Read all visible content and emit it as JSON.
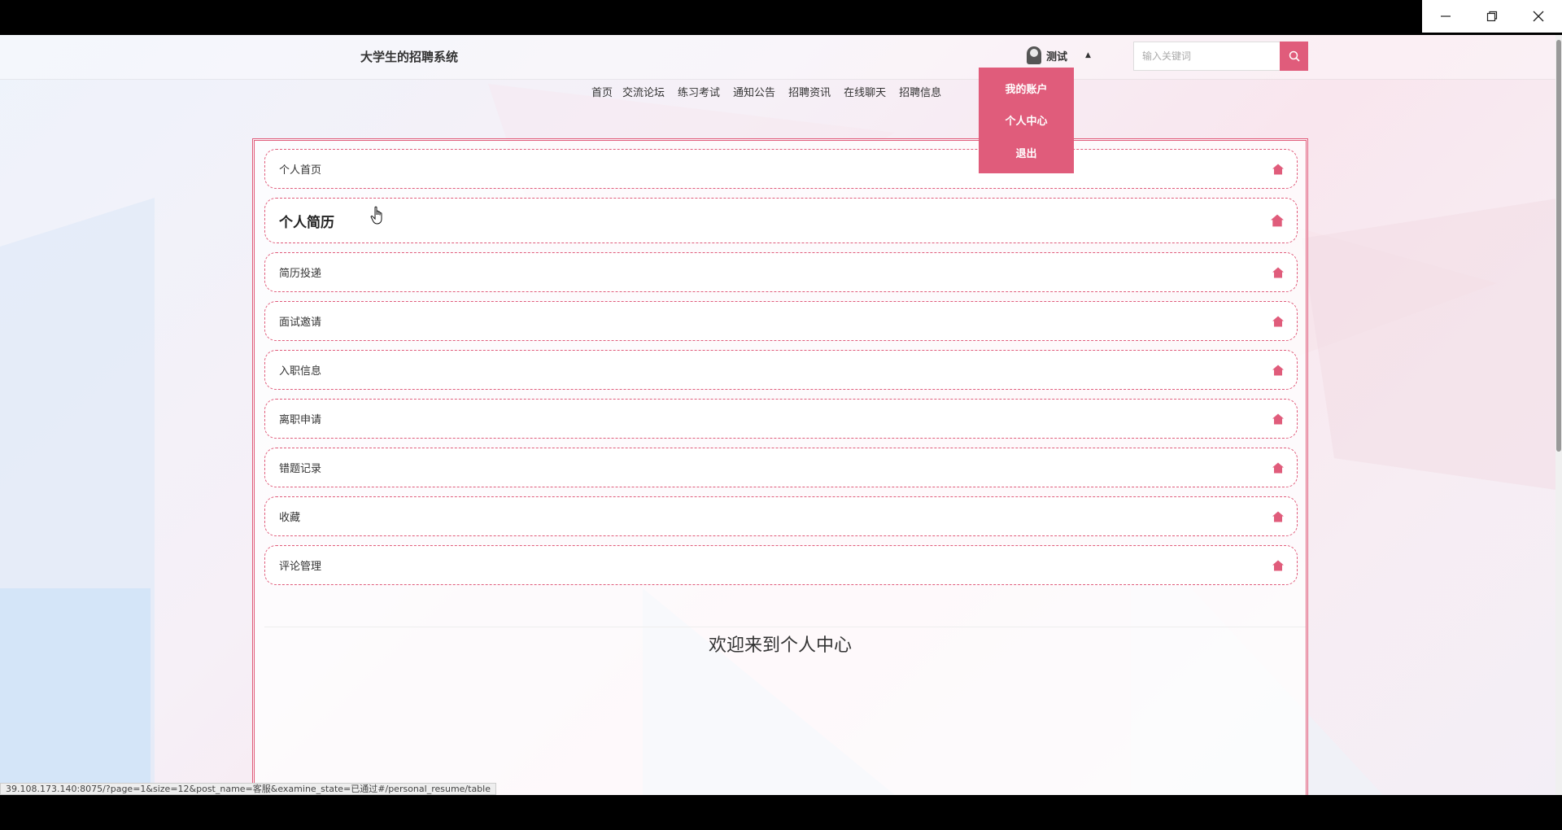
{
  "window": {
    "minimize_label": "—",
    "restore_label": "❐",
    "close_label": "✕"
  },
  "header": {
    "site_title": "大学生的招聘系统",
    "user_name": "测试",
    "search_placeholder": "输入关键词"
  },
  "nav": {
    "items": [
      "首页",
      "交流论坛",
      "练习考试",
      "通知公告",
      "招聘资讯",
      "在线聊天",
      "招聘信息"
    ]
  },
  "dropdown": {
    "items": [
      "我的账户",
      "个人中心",
      "退出"
    ]
  },
  "menu": {
    "items": [
      {
        "label": "个人首页"
      },
      {
        "label": "个人简历"
      },
      {
        "label": "简历投递"
      },
      {
        "label": "面试邀请"
      },
      {
        "label": "入职信息"
      },
      {
        "label": "离职申请"
      },
      {
        "label": "错题记录"
      },
      {
        "label": "收藏"
      },
      {
        "label": "评论管理"
      }
    ],
    "active_index": 1
  },
  "main": {
    "welcome": "欢迎来到个人中心"
  },
  "status_bar": {
    "url": "39.108.173.140:8075/?page=1&size=12&post_name=客服&examine_state=已通过#/personal_resume/table"
  },
  "colors": {
    "accent": "#e05c7b"
  }
}
